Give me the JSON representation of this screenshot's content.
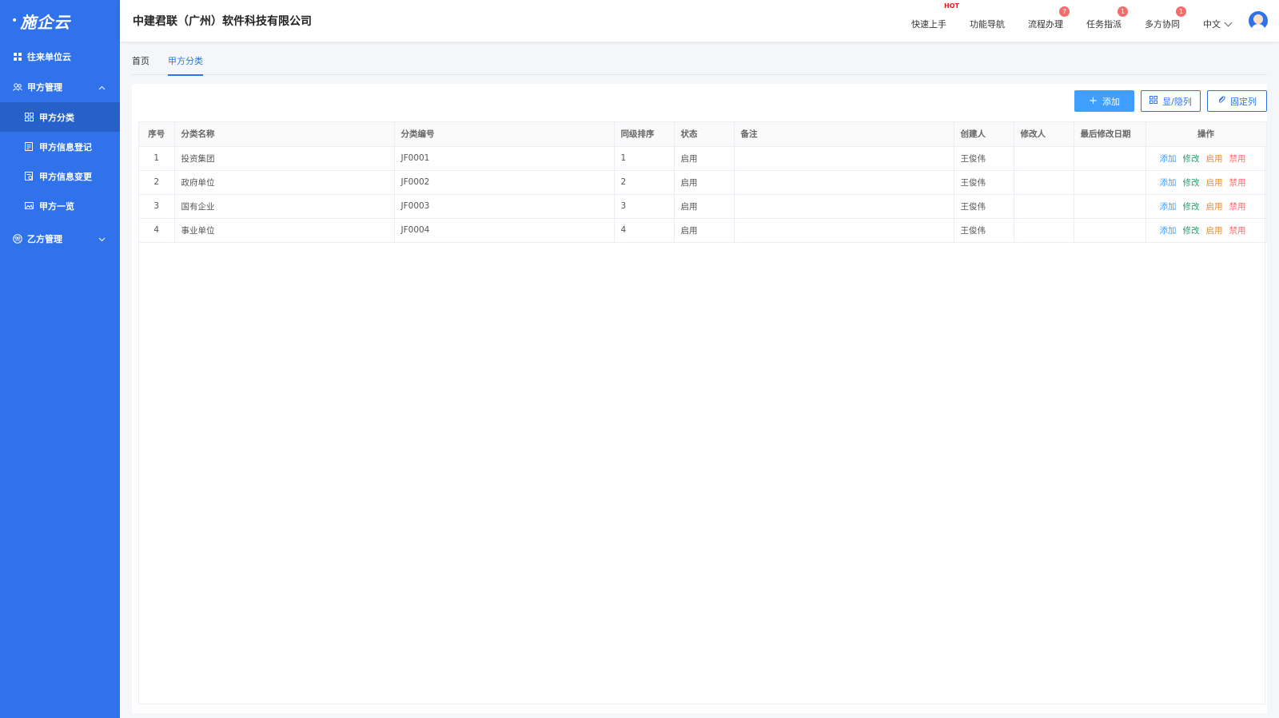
{
  "logo": {
    "text": "施企云"
  },
  "sidebar": {
    "top_item": "往来单位云",
    "group1": {
      "label": "甲方管理",
      "items": [
        "甲方分类",
        "甲方信息登记",
        "甲方信息变更",
        "甲方一览"
      ]
    },
    "group2": {
      "label": "乙方管理"
    }
  },
  "header": {
    "company": "中建君联（广州）软件科技有限公司",
    "nav": [
      {
        "label": "快速上手",
        "hot": "HOT"
      },
      {
        "label": "功能导航"
      },
      {
        "label": "流程办理",
        "badge": "7"
      },
      {
        "label": "任务指派",
        "badge": "1"
      },
      {
        "label": "多方协同",
        "badge": "1"
      }
    ],
    "lang": "中文"
  },
  "tabs": [
    "首页",
    "甲方分类"
  ],
  "toolbar": {
    "add": "添加",
    "toggle_cols": "显/隐列",
    "fix_cols": "固定列"
  },
  "table": {
    "columns": [
      "序号",
      "分类名称",
      "分类编号",
      "同级排序",
      "状态",
      "备注",
      "创建人",
      "修改人",
      "最后修改日期",
      "操作"
    ],
    "rows": [
      [
        "1",
        "投资集团",
        "JF0001",
        "1",
        "启用",
        "",
        "王俊伟",
        "",
        ""
      ],
      [
        "2",
        "政府单位",
        "JF0002",
        "2",
        "启用",
        "",
        "王俊伟",
        "",
        ""
      ],
      [
        "3",
        "国有企业",
        "JF0003",
        "3",
        "启用",
        "",
        "王俊伟",
        "",
        ""
      ],
      [
        "4",
        "事业单位",
        "JF0004",
        "4",
        "启用",
        "",
        "王俊伟",
        "",
        ""
      ]
    ],
    "actions": [
      "添加",
      "修改",
      "启用",
      "禁用"
    ]
  },
  "colors": {
    "sidebar": "#2f72ea",
    "primary": "#409eff",
    "edit": "#22a06b",
    "enable": "#f08a24",
    "disable": "#f56c6c"
  }
}
